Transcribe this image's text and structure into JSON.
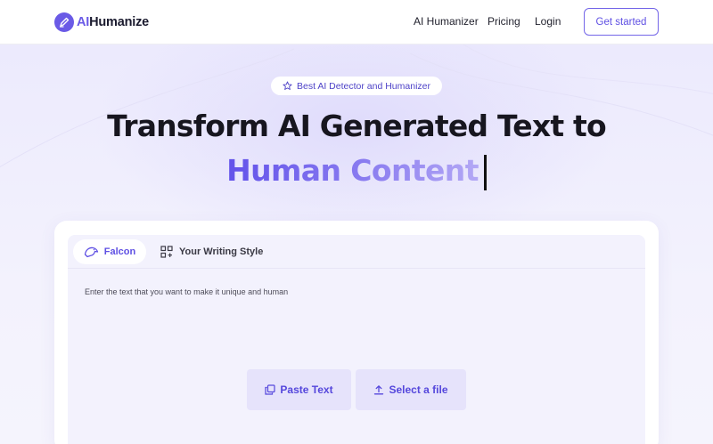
{
  "header": {
    "logo_ai": "AI",
    "logo_rest": "Humanize",
    "nav": [
      "AI Humanizer",
      "Pricing",
      "Login"
    ],
    "cta_label": "Get started"
  },
  "hero": {
    "badge_icon": "star-icon",
    "badge_text": "Best AI Detector and Humanizer",
    "headline_line1": "Transform AI Generated Text to",
    "headline_line2": "Human Content"
  },
  "editor": {
    "tabs": [
      {
        "label": "Falcon",
        "icon": "falcon-bird-icon",
        "active": true
      },
      {
        "label": "Your Writing Style",
        "icon": "qr-grid-icon",
        "active": false
      }
    ],
    "placeholder": "Enter the text that you want to make it unique and human",
    "actions": [
      {
        "label": "Paste Text",
        "icon": "copy-icon"
      },
      {
        "label": "Select a file",
        "icon": "upload-icon"
      }
    ]
  },
  "colors": {
    "brand": "#6a5ae6",
    "background": "#f3f2fd",
    "button_tint": "#e6e3fb"
  }
}
